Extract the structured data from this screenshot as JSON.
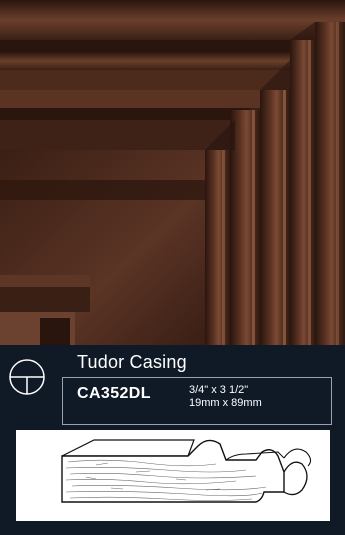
{
  "product": {
    "name": "Tudor Casing",
    "sku": "CA352DL",
    "dimensions_imperial": "3/4\" x 3 1/2\"",
    "dimensions_metric": "19mm x 89mm"
  },
  "colors": {
    "panel_background": "#0f1a26",
    "wood_dark": "#3a1f15",
    "wood_light": "#7a4a35",
    "text": "#ffffff",
    "box_border": "#9aa3ad"
  },
  "icons": {
    "brand_logo": "circle-with-crosshair",
    "profile_drawing": "moulding-profile-cross-section"
  }
}
